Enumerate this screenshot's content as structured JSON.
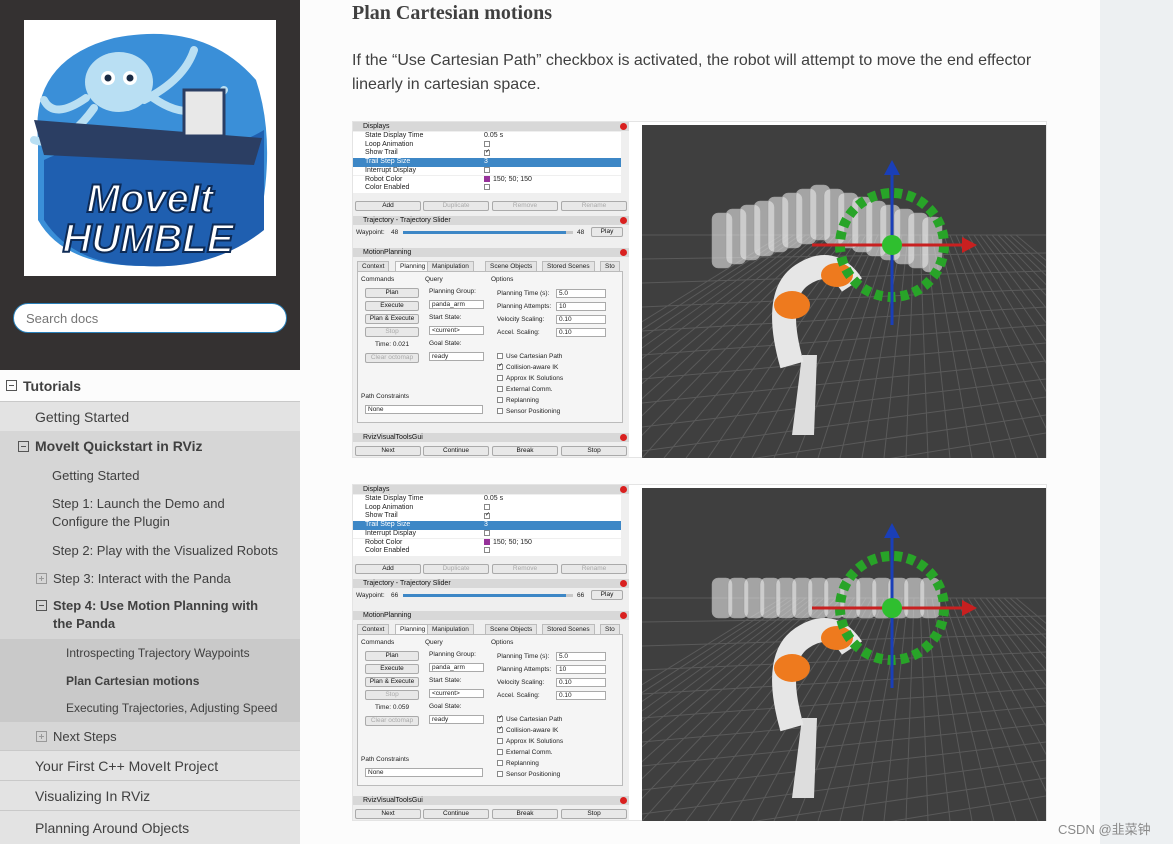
{
  "sidebar": {
    "logo": {
      "line1": "MoveIt",
      "line2": "HUMBLE"
    },
    "search_placeholder": "Search docs",
    "nav": {
      "tutorials": "Tutorials",
      "getting_started": "Getting Started",
      "quickstart": "MoveIt Quickstart in RViz",
      "qs_getting_started": "Getting Started",
      "step1": "Step 1: Launch the Demo and Configure the Plugin",
      "step2": "Step 2: Play with the Visualized Robots",
      "step3": "Step 3: Interact with the Panda",
      "step4": "Step 4: Use Motion Planning with the Panda",
      "introspecting": "Introspecting Trajectory Waypoints",
      "plan_cartesian": "Plan Cartesian motions",
      "executing": "Executing Trajectories, Adjusting Speed",
      "next_steps": "Next Steps",
      "first_cpp": "Your First C++ MoveIt Project",
      "visualizing": "Visualizing In RViz",
      "planning_around": "Planning Around Objects"
    }
  },
  "content": {
    "heading": "Plan Cartesian motions",
    "paragraph": "If the “Use Cartesian Path” checkbox is activated, the robot will attempt to move the end effector linearly in cartesian space."
  },
  "shots": [
    {
      "time": "Time: 0.021",
      "waypoint": "48",
      "slider": 0.96,
      "cartesian": false
    },
    {
      "time": "Time: 0.059",
      "waypoint": "66",
      "slider": 0.96,
      "cartesian": true
    }
  ],
  "rviz": {
    "displays_title": "Displays",
    "rows": [
      {
        "k": "State Display Time",
        "v": "0.05 s"
      },
      {
        "k": "Loop Animation",
        "v": ""
      },
      {
        "k": "Show Trail",
        "v": ""
      },
      {
        "k": "Trail Step Size",
        "v": "3"
      },
      {
        "k": "Interrupt Display",
        "v": ""
      },
      {
        "k": "Robot Color",
        "v": "150; 50; 150"
      },
      {
        "k": "Color Enabled",
        "v": ""
      }
    ],
    "add": "Add",
    "duplicate": "Duplicate",
    "remove": "Remove",
    "rename": "Rename",
    "slider_title": "Trajectory - Trajectory Slider",
    "waypoint_label": "Waypoint:",
    "play": "Play",
    "mp_title": "MotionPlanning",
    "tabs": [
      "Context",
      "Planning",
      "Manipulation",
      "Scene Objects",
      "Stored Scenes",
      "Sto"
    ],
    "commands": "Commands",
    "query": "Query",
    "options": "Options",
    "plan": "Plan",
    "execute": "Execute",
    "plan_execute": "Plan & Execute",
    "stop": "Stop",
    "clear_octomap": "Clear octomap",
    "planning_group": "Planning Group:",
    "group_value": "panda_arm",
    "start_state": "Start State:",
    "start_value": "<current>",
    "goal_state": "Goal State:",
    "goal_value": "ready",
    "planning_time": "Planning Time (s):",
    "planning_time_v": "5.0",
    "planning_attempts": "Planning Attempts:",
    "planning_attempts_v": "10",
    "velocity": "Velocity Scaling:",
    "velocity_v": "0.10",
    "accel": "Accel. Scaling:",
    "accel_v": "0.10",
    "checks": [
      "Use Cartesian Path",
      "Collision-aware IK",
      "Approx IK Solutions",
      "External Comm.",
      "Replanning",
      "Sensor Positioning"
    ],
    "path_constraints": "Path Constraints",
    "none": "None",
    "tools_title": "RvizVisualToolsGui",
    "next": "Next",
    "continue": "Continue",
    "break": "Break",
    "stop2": "Stop"
  },
  "watermark": "CSDN @韭菜钟",
  "colors": {
    "sidebar": "#343131",
    "accent": "#2980b9",
    "selected_row": "#3d87c6"
  }
}
